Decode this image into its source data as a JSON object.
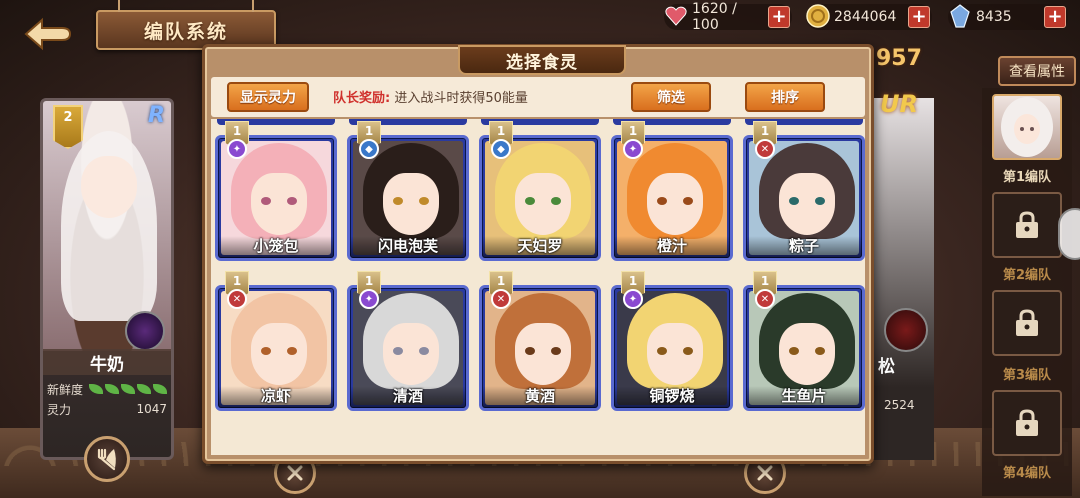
{
  "header": {
    "title": "编队系统",
    "back_icon": "back-arrow-icon"
  },
  "resources": [
    {
      "icon": "heart-icon",
      "value": "1620 / 100",
      "color": "#e05a6a"
    },
    {
      "icon": "coin-icon",
      "value": "2844064",
      "color": "#e0b040"
    },
    {
      "icon": "crystal-icon",
      "value": "8435",
      "color": "#7aa8e0"
    }
  ],
  "left_card": {
    "rank": "2",
    "rarity": "R",
    "name": "牛奶",
    "freshness_label": "新鲜度",
    "freshness_leaves": 5,
    "power_label": "灵力",
    "power_value": "1047"
  },
  "right_card": {
    "power_display": "957",
    "rarity": "UR",
    "name": "松",
    "value": "2524",
    "view_attr_label": "查看属性"
  },
  "teams": [
    {
      "label": "第1编队",
      "active": true
    },
    {
      "label": "第2编队",
      "active": false
    },
    {
      "label": "第3编队",
      "active": false
    },
    {
      "label": "第4编队",
      "active": false
    }
  ],
  "modal": {
    "title": "选择食灵",
    "show_spirit_btn": "显示灵力",
    "captain_label": "队长奖励:",
    "captain_text": "进入战斗时获得50能量",
    "filter_btn": "筛选",
    "sort_btn": "排序"
  },
  "characters": [
    {
      "name": "小笼包",
      "rank": "1",
      "element": "purple",
      "hair": "#f4b0b8",
      "bg": "#f6d8dc",
      "eye": "#b05a7a"
    },
    {
      "name": "闪电泡芙",
      "rank": "1",
      "element": "blue",
      "hair": "#2a1e1a",
      "bg": "#5a4a48",
      "eye": "#c08a2a"
    },
    {
      "name": "天妇罗",
      "rank": "1",
      "element": "blue",
      "hair": "#f2d472",
      "bg": "#e7c07a",
      "eye": "#4a8a3a"
    },
    {
      "name": "橙汁",
      "rank": "1",
      "element": "purple",
      "hair": "#f08a30",
      "bg": "#f4b06a",
      "eye": "#9a4a1a"
    },
    {
      "name": "粽子",
      "rank": "1",
      "element": "red",
      "hair": "#4a3a3a",
      "bg": "#a9c4d8",
      "eye": "#2a6a6a"
    },
    {
      "name": "凉虾",
      "rank": "1",
      "element": "red",
      "hair": "#f2c4a4",
      "bg": "#f7dcc4",
      "eye": "#b0602a"
    },
    {
      "name": "清酒",
      "rank": "1",
      "element": "purple",
      "hair": "#d8d8d8",
      "bg": "#4a4a58",
      "eye": "#8a8aa0"
    },
    {
      "name": "黄酒",
      "rank": "1",
      "element": "red",
      "hair": "#c0703a",
      "bg": "#e2b48a",
      "eye": "#6a3a1a"
    },
    {
      "name": "铜锣烧",
      "rank": "1",
      "element": "purple",
      "hair": "#f2d472",
      "bg": "#3a3a4a",
      "eye": "#8a5a1a"
    },
    {
      "name": "生鱼片",
      "rank": "1",
      "element": "red",
      "hair": "#2a3a2a",
      "bg": "#b8c8b8",
      "eye": "#8a5a1a"
    }
  ]
}
